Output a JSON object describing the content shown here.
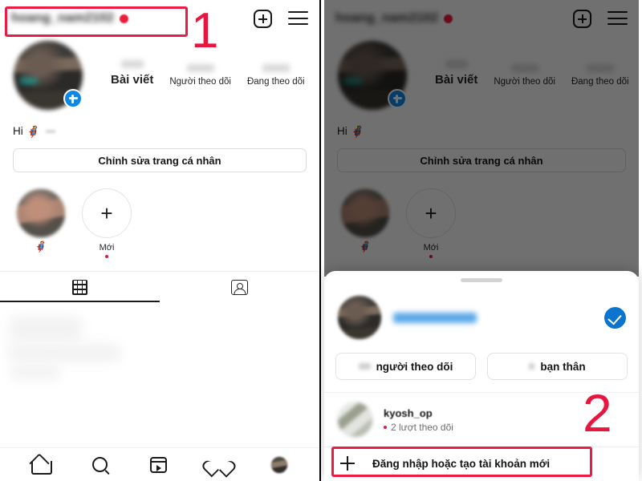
{
  "meta": {
    "app": "Instagram",
    "language": "vi",
    "accent_blue": "#0e88e8",
    "annotation_red": "#ed1b44",
    "badge_red": "#ed1b3c",
    "check_blue": "#0b74cf",
    "text_primary": "#161616",
    "text_secondary": "#6e6e6e"
  },
  "annotations": [
    {
      "label": "1",
      "target": "username-header"
    },
    {
      "label": "2",
      "target": "add-account-row"
    }
  ],
  "profile": {
    "username": "hoang_nam2102",
    "username_blurred": true,
    "header": {
      "add_icon": "plus-box-icon",
      "menu_icon": "hamburger-menu-icon",
      "notification_dot": "red-dot-badge"
    },
    "avatar": {
      "name": "profile-avatar",
      "add_story_icon": "plus-circle-icon"
    },
    "stats": [
      {
        "value": "",
        "label": "Bài viết"
      },
      {
        "value": "",
        "label": "Người theo dõi"
      },
      {
        "value": "",
        "label": "Đang theo dõi"
      }
    ],
    "bio": {
      "text": "Hi",
      "emoji": "🦸"
    },
    "edit_button": "Chỉnh sửa trang cá nhân",
    "highlights": [
      {
        "type": "photo",
        "label": "",
        "emoji": "🦸",
        "is_new": false
      },
      {
        "type": "new",
        "label": "Mới",
        "emoji": "",
        "is_new": true
      }
    ],
    "tabs": [
      {
        "icon": "grid-icon",
        "active": true
      },
      {
        "icon": "tagged-person-icon",
        "active": false
      }
    ],
    "bottom_nav": [
      {
        "icon": "home-icon",
        "active": true
      },
      {
        "icon": "search-icon",
        "active": false
      },
      {
        "icon": "reels-icon",
        "active": false
      },
      {
        "icon": "heart-icon",
        "active": false
      },
      {
        "icon": "profile-avatar-icon",
        "active": false
      }
    ]
  },
  "account_sheet": {
    "grabber": "drag-handle",
    "current_account": {
      "username": "hoang_nam2102",
      "username_blurred": true,
      "selected": true,
      "check_icon": "blue-check-icon"
    },
    "quick_buttons": [
      {
        "count": "",
        "label": "người theo dõi"
      },
      {
        "count": "",
        "label": "bạn thân"
      }
    ],
    "other_accounts": [
      {
        "username": "kyosh_op",
        "subtitle": "2 lượt theo dõi",
        "has_unread_dot": true
      }
    ],
    "add_account": {
      "icon": "plus-icon",
      "label": "Đăng nhập hoặc tạo tài khoản mới"
    }
  }
}
